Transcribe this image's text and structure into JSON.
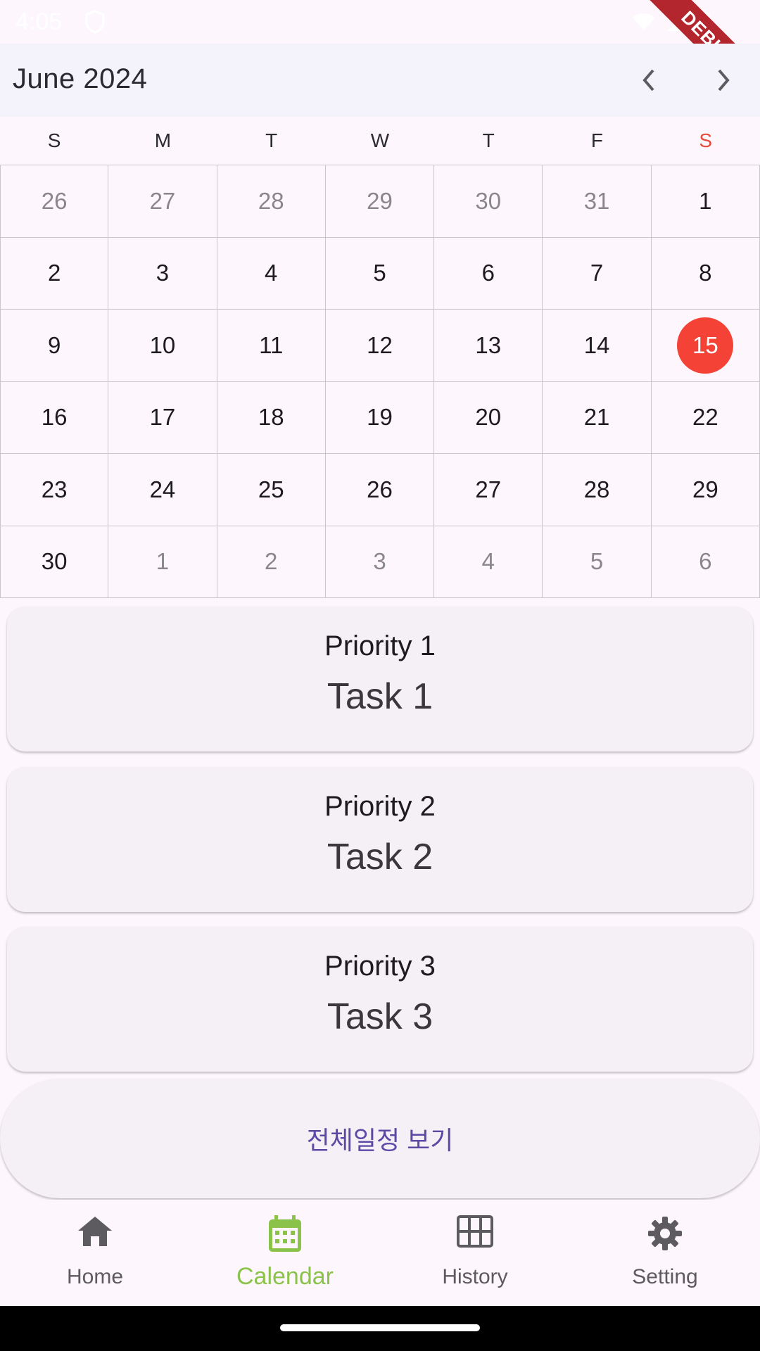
{
  "status_bar": {
    "time": "4:05"
  },
  "debug_label": "DEBUG",
  "header": {
    "month": "June 2024"
  },
  "weekdays": [
    "S",
    "M",
    "T",
    "W",
    "T",
    "F",
    "S"
  ],
  "days": [
    {
      "d": "26",
      "muted": true
    },
    {
      "d": "27",
      "muted": true
    },
    {
      "d": "28",
      "muted": true
    },
    {
      "d": "29",
      "muted": true
    },
    {
      "d": "30",
      "muted": true
    },
    {
      "d": "31",
      "muted": true
    },
    {
      "d": "1"
    },
    {
      "d": "2"
    },
    {
      "d": "3"
    },
    {
      "d": "4"
    },
    {
      "d": "5"
    },
    {
      "d": "6"
    },
    {
      "d": "7"
    },
    {
      "d": "8"
    },
    {
      "d": "9"
    },
    {
      "d": "10"
    },
    {
      "d": "11"
    },
    {
      "d": "12"
    },
    {
      "d": "13"
    },
    {
      "d": "14"
    },
    {
      "d": "15",
      "today": true
    },
    {
      "d": "16"
    },
    {
      "d": "17"
    },
    {
      "d": "18"
    },
    {
      "d": "19"
    },
    {
      "d": "20"
    },
    {
      "d": "21"
    },
    {
      "d": "22"
    },
    {
      "d": "23"
    },
    {
      "d": "24"
    },
    {
      "d": "25"
    },
    {
      "d": "26"
    },
    {
      "d": "27"
    },
    {
      "d": "28"
    },
    {
      "d": "29"
    },
    {
      "d": "30"
    },
    {
      "d": "1",
      "muted": true
    },
    {
      "d": "2",
      "muted": true
    },
    {
      "d": "3",
      "muted": true
    },
    {
      "d": "4",
      "muted": true
    },
    {
      "d": "5",
      "muted": true
    },
    {
      "d": "6",
      "muted": true
    }
  ],
  "tasks": [
    {
      "priority": "Priority 1",
      "name": "Task 1"
    },
    {
      "priority": "Priority 2",
      "name": "Task 2"
    },
    {
      "priority": "Priority 3",
      "name": "Task 3"
    }
  ],
  "view_all_label": "전체일정 보기",
  "nav": [
    {
      "label": "Home",
      "icon": "home-icon"
    },
    {
      "label": "Calendar",
      "icon": "calendar-icon",
      "active": true
    },
    {
      "label": "History",
      "icon": "grid-icon"
    },
    {
      "label": "Setting",
      "icon": "gear-icon"
    }
  ],
  "colors": {
    "today": "#f44336",
    "saturday": "#e64a3b",
    "active_nav": "#8bc34a",
    "link": "#5a4aa6"
  }
}
